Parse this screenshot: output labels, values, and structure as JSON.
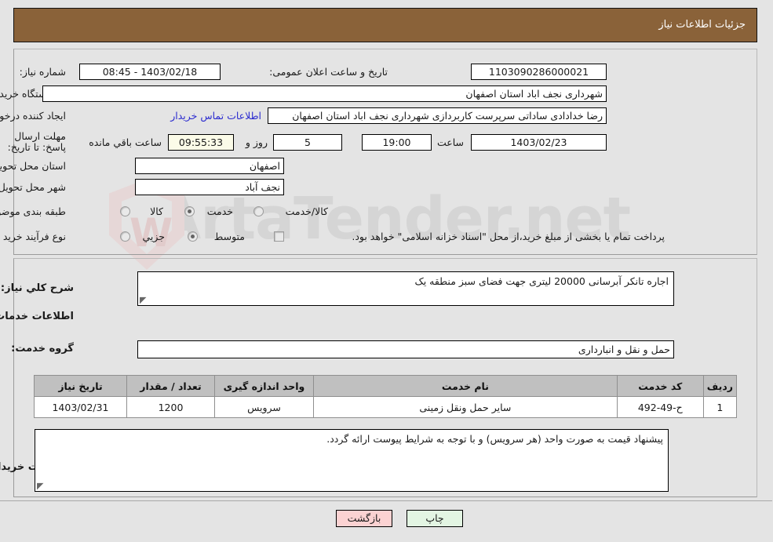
{
  "header": {
    "title": "جزئیات اطلاعات نیاز"
  },
  "watermark": {
    "text": "ArtaTender.net",
    "letter": "W"
  },
  "form": {
    "need_number": {
      "label": "شماره نیاز:",
      "value": "1103090286000021"
    },
    "announce_datetime": {
      "label": "تاریخ و ساعت اعلان عمومی:",
      "value": "1403/02/18 - 08:45"
    },
    "buyer_org": {
      "label": "نام دستگاه خریدار:",
      "value": "شهرداری نجف اباد استان اصفهان"
    },
    "requester": {
      "label": "ایجاد کننده درخواست:",
      "value": "رضا خدادادی ساداتی سرپرست  کاربردازی شهرداری نجف اباد استان اصفهان",
      "contact_link": "اطلاعات تماس خریدار"
    },
    "deadline": {
      "label": "مهلت ارسال پاسخ: تا تاریخ:",
      "date": "1403/02/23",
      "time_label": "ساعت",
      "time": "19:00",
      "days": "5",
      "days_label": "روز و",
      "countdown": "09:55:33",
      "countdown_label": "ساعت باقي مانده"
    },
    "delivery_province": {
      "label": "استان محل تحویل:",
      "value": "اصفهان"
    },
    "delivery_city": {
      "label": "شهر محل تحویل:",
      "value": "نجف آباد"
    },
    "category": {
      "label": "طبقه بندی موضوعی:",
      "options": [
        "کالا",
        "خدمت",
        "کالا/خدمت"
      ],
      "selected": "خدمت"
    },
    "purchase_process": {
      "label": "نوع فرآیند خرید :",
      "options": [
        "جزیي",
        "متوسط"
      ],
      "selected": "متوسط",
      "treasury_note": "پرداخت تمام یا بخشی از مبلغ خرید،از محل \"اسناد خزانه اسلامی\" خواهد بود.",
      "treasury_checked": false
    }
  },
  "need_summary": {
    "label": "شرح کلي نیاز:",
    "value": "اجاره تانکر آبرسانی 20000 لیتری جهت فضای سبز منطقه یک"
  },
  "services_section": {
    "heading": "اطلاعات خدمات مورد نیاز",
    "group_label": "گروه خدمت:",
    "group_value": "حمل و نقل و انبارداری"
  },
  "table": {
    "columns": [
      "ردیف",
      "کد خدمت",
      "نام خدمت",
      "واحد اندازه گیری",
      "تعداد / مقدار",
      "تاریخ نیاز"
    ],
    "rows": [
      {
        "row_no": "1",
        "service_code": "ح-49-492",
        "service_name": "سایر حمل ونقل زمینی",
        "unit": "سرویس",
        "quantity": "1200",
        "need_date": "1403/02/31"
      }
    ]
  },
  "buyer_notes": {
    "label": "توضیحات خریدار:",
    "value": "پیشنهاد قیمت به صورت واحد (هر سرویس) و با توجه به شرایط پیوست ارائه گردد."
  },
  "footer": {
    "back_label": "بازگشت",
    "print_label": "چاپ"
  }
}
